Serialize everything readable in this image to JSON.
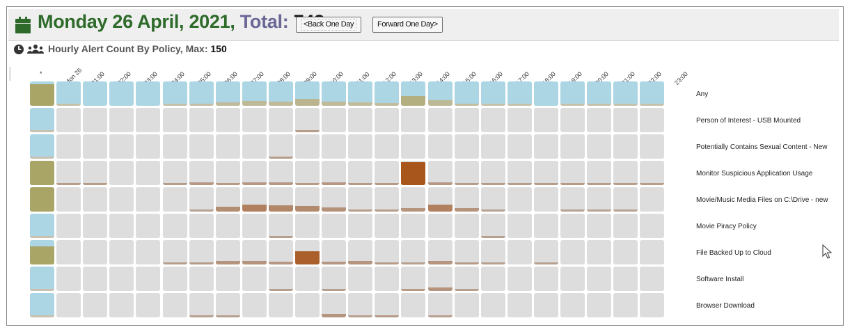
{
  "header": {
    "date": "Monday 26 April, 2021",
    "comma": ",",
    "total_label": "Total:",
    "total_value": "748",
    "back_button": "<Back One Day",
    "forward_button": "Forward One Day>"
  },
  "subheader": {
    "title": "Hourly Alert Count By Policy, Max:",
    "max": "150"
  },
  "columns": [
    "*",
    "Mon 26",
    "01:00",
    "02:00",
    "03:00",
    "04:00",
    "05:00",
    "06:00",
    "07:00",
    "08:00",
    "09:00",
    "10:00",
    "11:00",
    "12:00",
    "13:00",
    "14:00",
    "15:00",
    "16:00",
    "17:00",
    "18:00",
    "19:00",
    "20:00",
    "21:00",
    "22:00",
    "23:00"
  ],
  "rows": [
    {
      "label": "Any",
      "values": [
        90,
        5,
        0,
        0,
        0,
        5,
        8,
        15,
        20,
        18,
        28,
        18,
        14,
        12,
        40,
        22,
        10,
        2,
        2,
        0,
        2,
        2,
        2,
        2
      ]
    },
    {
      "label": "Person of Interest - USB Mounted",
      "values": [
        5,
        0,
        0,
        0,
        0,
        0,
        0,
        0,
        0,
        0,
        8,
        0,
        0,
        0,
        0,
        0,
        0,
        0,
        0,
        0,
        0,
        0,
        0,
        0
      ]
    },
    {
      "label": "Potentially Contains Sexual Content - New",
      "values": [
        1,
        0,
        0,
        0,
        0,
        0,
        0,
        0,
        0,
        8,
        0,
        0,
        0,
        0,
        0,
        0,
        0,
        0,
        0,
        0,
        0,
        0,
        0,
        0
      ]
    },
    {
      "label": "Monitor Suspicious Application Usage",
      "values": [
        100,
        8,
        8,
        0,
        0,
        8,
        12,
        10,
        12,
        12,
        10,
        12,
        10,
        10,
        95,
        12,
        8,
        8,
        8,
        8,
        10,
        8,
        8,
        8
      ]
    },
    {
      "label": "Movie/Music Media Files on C:\\Drive - new",
      "values": [
        100,
        0,
        0,
        0,
        0,
        0,
        5,
        20,
        30,
        25,
        22,
        16,
        8,
        8,
        15,
        30,
        15,
        5,
        0,
        0,
        5,
        5,
        5,
        0
      ]
    },
    {
      "label": "Movie Piracy Policy",
      "values": [
        1,
        0,
        0,
        0,
        0,
        0,
        0,
        0,
        0,
        6,
        0,
        0,
        0,
        0,
        0,
        0,
        0,
        6,
        0,
        0,
        0,
        0,
        0,
        0
      ]
    },
    {
      "label": "File Backed Up to Cloud",
      "values": [
        75,
        0,
        0,
        0,
        0,
        8,
        10,
        15,
        15,
        12,
        55,
        12,
        14,
        10,
        6,
        14,
        10,
        6,
        0,
        6,
        0,
        0,
        0,
        0
      ]
    },
    {
      "label": "Software Install",
      "values": [
        10,
        0,
        0,
        0,
        0,
        0,
        0,
        0,
        0,
        6,
        0,
        6,
        0,
        0,
        10,
        15,
        6,
        0,
        0,
        0,
        0,
        0,
        0,
        0
      ]
    },
    {
      "label": "Browser Download",
      "values": [
        8,
        0,
        0,
        0,
        0,
        0,
        6,
        6,
        0,
        0,
        0,
        14,
        6,
        10,
        0,
        6,
        0,
        0,
        0,
        0,
        0,
        0,
        0,
        0
      ]
    }
  ],
  "colors": {
    "title_green": "#2e6b2a",
    "total_purple": "#6a6796",
    "summary_blue": "#acd6e4",
    "empty_cell": "#dddddd",
    "bar_low": "#b8a79a",
    "bar_high": "#a9561c",
    "summary_olive": "#a8a566"
  },
  "icons": [
    "calendar-icon",
    "clock-icon",
    "users-icon",
    "cursor-icon"
  ]
}
